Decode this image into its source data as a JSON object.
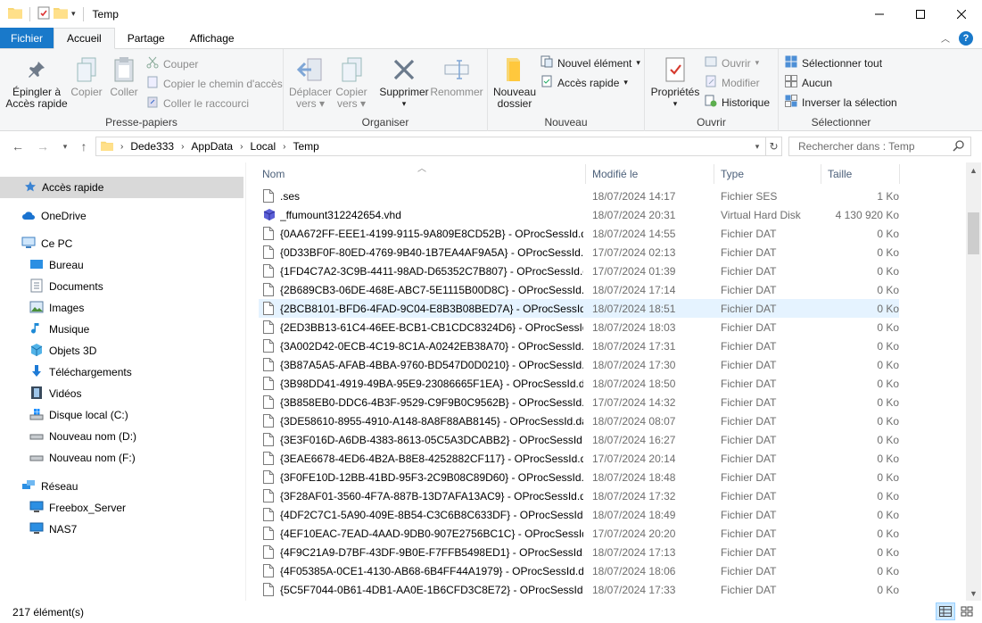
{
  "window": {
    "title": "Temp"
  },
  "tabs": {
    "file": "Fichier",
    "home": "Accueil",
    "share": "Partage",
    "view": "Affichage"
  },
  "ribbon": {
    "clipboard": {
      "label": "Presse-papiers",
      "pin": [
        "Épingler à",
        "Accès rapide"
      ],
      "copy": "Copier",
      "paste": "Coller",
      "cut": "Couper",
      "copy_path": "Copier le chemin d'accès",
      "paste_shortcut": "Coller le raccourci"
    },
    "organize": {
      "label": "Organiser",
      "move": [
        "Déplacer",
        "vers"
      ],
      "copy_to": [
        "Copier",
        "vers"
      ],
      "delete": "Supprimer",
      "rename": "Renommer"
    },
    "new": {
      "label": "Nouveau",
      "new_folder": [
        "Nouveau",
        "dossier"
      ],
      "new_item": "Nouvel élément",
      "easy_access": "Accès rapide"
    },
    "open": {
      "label": "Ouvrir",
      "properties": "Propriétés",
      "open": "Ouvrir",
      "edit": "Modifier",
      "history": "Historique"
    },
    "select": {
      "label": "Sélectionner",
      "select_all": "Sélectionner tout",
      "select_none": "Aucun",
      "invert": "Inverser la sélection"
    }
  },
  "address": {
    "crumbs": [
      "Dede333",
      "AppData",
      "Local",
      "Temp"
    ],
    "search_placeholder": "Rechercher dans : Temp"
  },
  "nav": {
    "quick_access": "Accès rapide",
    "onedrive": "OneDrive",
    "this_pc": "Ce PC",
    "desktop": "Bureau",
    "documents": "Documents",
    "pictures": "Images",
    "music": "Musique",
    "objects3d": "Objets 3D",
    "downloads": "Téléchargements",
    "videos": "Vidéos",
    "local_disk": "Disque local (C:)",
    "drive_d": "Nouveau nom (D:)",
    "drive_f": "Nouveau nom (F:)",
    "network": "Réseau",
    "freebox": "Freebox_Server",
    "nas": "NAS7"
  },
  "columns": {
    "name": "Nom",
    "modified": "Modifié le",
    "type": "Type",
    "size": "Taille"
  },
  "files": [
    {
      "name": ".ses",
      "date": "18/07/2024 14:17",
      "type": "Fichier SES",
      "size": "1 Ko"
    },
    {
      "name": "_ffumount312242654.vhd",
      "date": "18/07/2024 20:31",
      "type": "Virtual Hard Disk",
      "size": "4 130 920 Ko"
    },
    {
      "name": "{0AA672FF-EEE1-4199-9115-9A809E8CD52B} - OProcSessId.dat",
      "date": "18/07/2024 14:55",
      "type": "Fichier DAT",
      "size": "0 Ko"
    },
    {
      "name": "{0D33BF0F-80ED-4769-9B40-1B7EA4AF9A5A} - OProcSessId.dat",
      "date": "17/07/2024 02:13",
      "type": "Fichier DAT",
      "size": "0 Ko"
    },
    {
      "name": "{1FD4C7A2-3C9B-4411-98AD-D65352C7B807} - OProcSessId.dat",
      "date": "17/07/2024 01:39",
      "type": "Fichier DAT",
      "size": "0 Ko"
    },
    {
      "name": "{2B689CB3-06DE-468E-ABC7-5E1115B00D8C} - OProcSessId.dat",
      "date": "18/07/2024 17:14",
      "type": "Fichier DAT",
      "size": "0 Ko"
    },
    {
      "name": "{2BCB8101-BFD6-4FAD-9C04-E8B3B08BED7A} - OProcSessId.dat",
      "date": "18/07/2024 18:51",
      "type": "Fichier DAT",
      "size": "0 Ko"
    },
    {
      "name": "{2ED3BB13-61C4-46EE-BCB1-CB1CDC8324D6} - OProcSessId....",
      "date": "18/07/2024 18:03",
      "type": "Fichier DAT",
      "size": "0 Ko"
    },
    {
      "name": "{3A002D42-0ECB-4C19-8C1A-A0242EB38A70} - OProcSessId.dat",
      "date": "18/07/2024 17:31",
      "type": "Fichier DAT",
      "size": "0 Ko"
    },
    {
      "name": "{3B87A5A5-AFAB-4BBA-9760-BD547D0D0210} - OProcSessId.d...",
      "date": "18/07/2024 17:30",
      "type": "Fichier DAT",
      "size": "0 Ko"
    },
    {
      "name": "{3B98DD41-4919-49BA-95E9-23086665F1EA} - OProcSessId.dat",
      "date": "18/07/2024 18:50",
      "type": "Fichier DAT",
      "size": "0 Ko"
    },
    {
      "name": "{3B858EB0-DDC6-4B3F-9529-C9F9B0C9562B} - OProcSessId.dat",
      "date": "17/07/2024 14:32",
      "type": "Fichier DAT",
      "size": "0 Ko"
    },
    {
      "name": "{3DE58610-8955-4910-A148-8A8F88AB8145} - OProcSessId.dat",
      "date": "18/07/2024 08:07",
      "type": "Fichier DAT",
      "size": "0 Ko"
    },
    {
      "name": "{3E3F016D-A6DB-4383-8613-05C5A3DCABB2} - OProcSessId.dat",
      "date": "18/07/2024 16:27",
      "type": "Fichier DAT",
      "size": "0 Ko"
    },
    {
      "name": "{3EAE6678-4ED6-4B2A-B8E8-4252882CF117} - OProcSessId.dat",
      "date": "17/07/2024 20:14",
      "type": "Fichier DAT",
      "size": "0 Ko"
    },
    {
      "name": "{3F0FE10D-12BB-41BD-95F3-2C9B08C89D60} - OProcSessId.dat",
      "date": "18/07/2024 18:48",
      "type": "Fichier DAT",
      "size": "0 Ko"
    },
    {
      "name": "{3F28AF01-3560-4F7A-887B-13D7AFA13AC9} - OProcSessId.dat",
      "date": "18/07/2024 17:32",
      "type": "Fichier DAT",
      "size": "0 Ko"
    },
    {
      "name": "{4DF2C7C1-5A90-409E-8B54-C3C6B8C633DF} - OProcSessId.dat",
      "date": "18/07/2024 18:49",
      "type": "Fichier DAT",
      "size": "0 Ko"
    },
    {
      "name": "{4EF10EAC-7EAD-4AAD-9DB0-907E2756BC1C} - OProcSessId....",
      "date": "17/07/2024 20:20",
      "type": "Fichier DAT",
      "size": "0 Ko"
    },
    {
      "name": "{4F9C21A9-D7BF-43DF-9B0E-F7FFB5498ED1} - OProcSessId.dat",
      "date": "18/07/2024 17:13",
      "type": "Fichier DAT",
      "size": "0 Ko"
    },
    {
      "name": "{4F05385A-0CE1-4130-AB68-6B4FF44A1979} - OProcSessId.dat",
      "date": "18/07/2024 18:06",
      "type": "Fichier DAT",
      "size": "0 Ko"
    },
    {
      "name": "{5C5F7044-0B61-4DB1-AA0E-1B6CFD3C8E72} - OProcSessId.dat",
      "date": "18/07/2024 17:33",
      "type": "Fichier DAT",
      "size": "0 Ko"
    }
  ],
  "hovered_row": 6,
  "status": {
    "count": "217 élément(s)"
  }
}
